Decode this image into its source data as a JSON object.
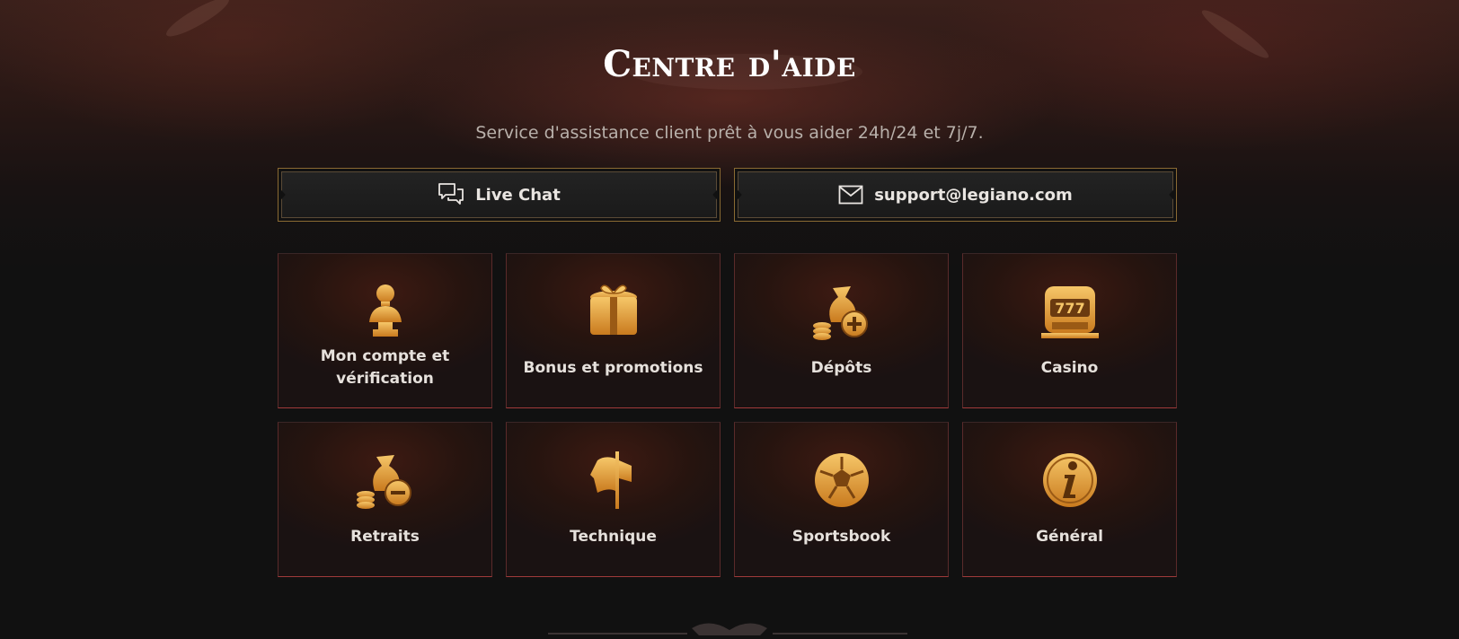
{
  "header": {
    "title": "Centre d'aide",
    "subtitle": "Service d'assistance client prêt à vous aider 24h/24 et 7j/7."
  },
  "contact": {
    "live_chat": {
      "label": "Live Chat",
      "icon": "chat-bubbles-icon"
    },
    "email": {
      "label": "support@legiano.com",
      "icon": "envelope-icon"
    }
  },
  "categories": [
    {
      "label": "Mon compte et vérification",
      "icon": "bust-statue-icon"
    },
    {
      "label": "Bonus et promotions",
      "icon": "gift-box-icon"
    },
    {
      "label": "Dépôts",
      "icon": "money-bag-plus-icon"
    },
    {
      "label": "Casino",
      "icon": "slot-machine-icon"
    },
    {
      "label": "Retraits",
      "icon": "money-bag-minus-icon"
    },
    {
      "label": "Technique",
      "icon": "banner-flag-icon"
    },
    {
      "label": "Sportsbook",
      "icon": "soccer-ball-icon"
    },
    {
      "label": "Général",
      "icon": "info-icon"
    }
  ],
  "colors": {
    "background": "#111111",
    "gold": "#e0a640",
    "card_border_accent": "#a03a3a",
    "button_border": "#8a6a33"
  }
}
